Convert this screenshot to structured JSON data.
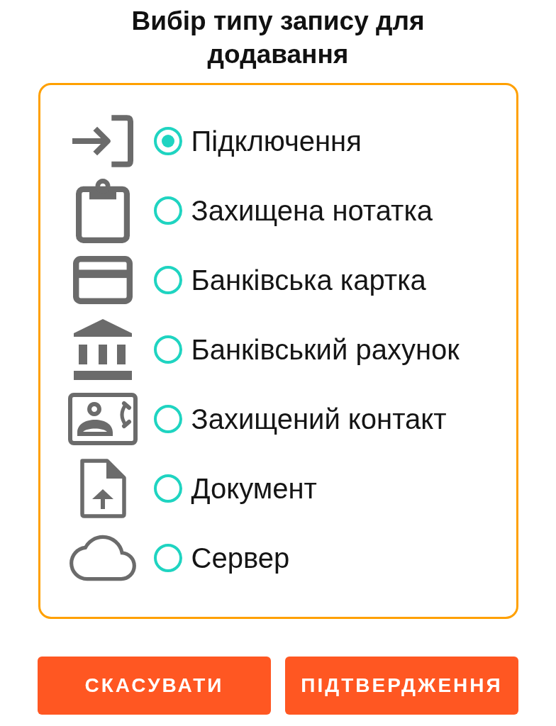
{
  "title": "Вибір типу запису для додавання",
  "options": [
    {
      "kind": "login",
      "label": "Підключення",
      "selected": true
    },
    {
      "kind": "note",
      "label": "Захищена нотатка",
      "selected": false
    },
    {
      "kind": "card",
      "label": "Банківська картка",
      "selected": false
    },
    {
      "kind": "bank",
      "label": "Банківський рахунок",
      "selected": false
    },
    {
      "kind": "contact",
      "label": "Захищений контакт",
      "selected": false
    },
    {
      "kind": "document",
      "label": "Документ",
      "selected": false
    },
    {
      "kind": "server",
      "label": "Сервер",
      "selected": false
    }
  ],
  "buttons": [
    "СКАСУВАТИ",
    "ПІДТВЕРДЖЕННЯ"
  ]
}
